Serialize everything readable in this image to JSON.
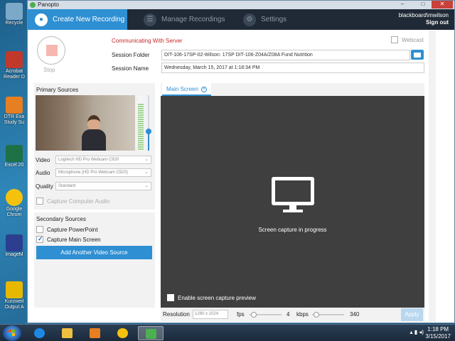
{
  "desktop": {
    "icons": [
      {
        "label": "Recycle",
        "color": "#7da9c9"
      },
      {
        "label": "Acrobat Reader D",
        "color": "#c0392b"
      },
      {
        "label": "DTR Exa Study Su",
        "color": "#e67e22"
      },
      {
        "label": "Excel 20",
        "color": "#1e7145"
      },
      {
        "label": "Google Chrom",
        "color": "#f4c20d"
      },
      {
        "label": "ImageM",
        "color": "#2c3e90"
      },
      {
        "label": "Kurzweil Output A",
        "color": "#e6b800"
      }
    ]
  },
  "window": {
    "title": "Panopto"
  },
  "nav": {
    "tabs": [
      {
        "label": "Create New Recording",
        "icon": "camera-icon",
        "glyph": "●"
      },
      {
        "label": "Manage Recordings",
        "icon": "list-icon",
        "glyph": "☰"
      },
      {
        "label": "Settings",
        "icon": "gear-icon",
        "glyph": "⚙"
      }
    ],
    "user": "blackboard\\mwilson",
    "signout": "Sign out"
  },
  "recording": {
    "stop_label": "Stop",
    "status": "Communicating With Server",
    "webcast_label": "Webcast",
    "folder_label": "Session Folder",
    "folder_value": "DIT-106-17SP-02-Wilson: 17SP DIT-106-Z04A/Z08A Fund Nutrition",
    "name_label": "Session Name",
    "name_value": "Wednesday, March 15, 2017 at 1:18:34 PM"
  },
  "primary": {
    "title": "Primary Sources",
    "audio_level": 0.85,
    "volume": 0.35,
    "video_label": "Video",
    "video_value": "Logitech HD Pro Webcam C920",
    "audio_label": "Audio",
    "audio_value": "Microphone (HD Pro Webcam C920)",
    "quality_label": "Quality",
    "quality_value": "Standard",
    "capture_audio_label": "Capture Computer Audio"
  },
  "secondary": {
    "title": "Secondary Sources",
    "ppt_label": "Capture PowerPoint",
    "ppt_checked": false,
    "screen_label": "Capture Main Screen",
    "screen_checked": true,
    "add_button": "Add Another Video Source"
  },
  "main": {
    "tab_label": "Main Screen",
    "message": "Screen capture in progress",
    "preview_label": "Enable screen capture preview",
    "resolution_label": "Resolution",
    "resolution_value": "1280 x 1024",
    "fps_label": "fps",
    "fps_value": "4",
    "kbps_label": "kbps",
    "kbps_value": "340",
    "apply_label": "Apply"
  },
  "taskbar": {
    "time": "1:18 PM",
    "date": "3/15/2017"
  }
}
